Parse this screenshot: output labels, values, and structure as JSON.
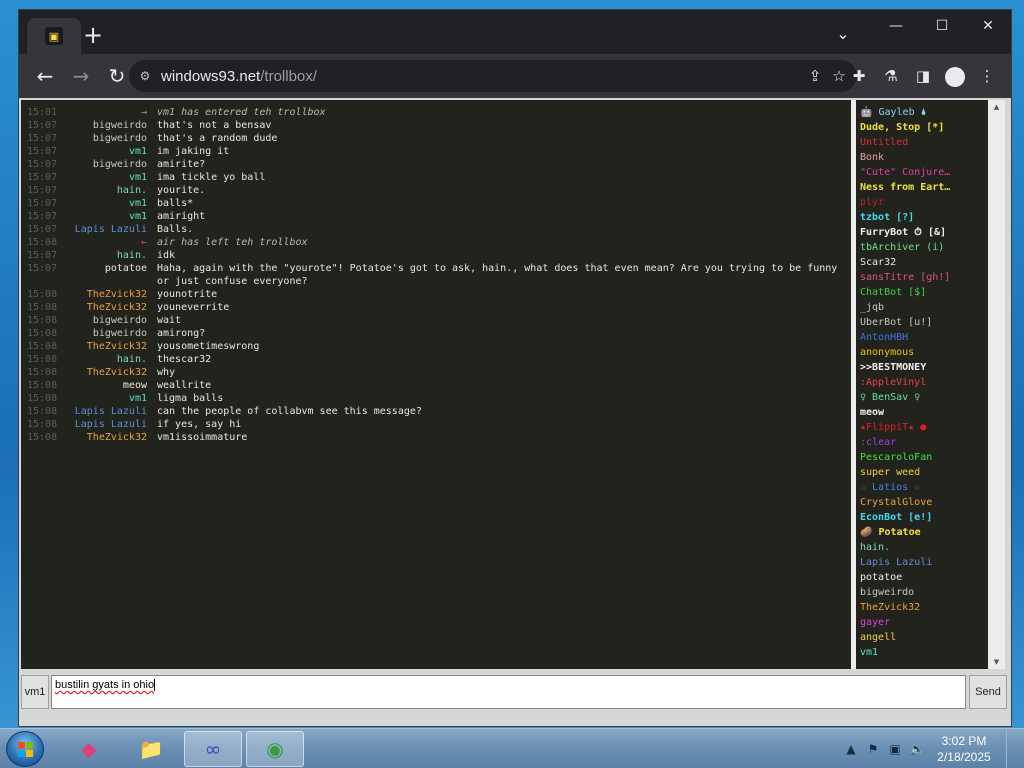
{
  "browser": {
    "new_tab_glyph": "+",
    "tab_search_glyph": "⌄",
    "url_host": "windows93.net",
    "url_path": "/trollbox/",
    "back_glyph": "←",
    "forward_glyph": "→",
    "reload_glyph": "↻",
    "site_info_glyph": "⚙",
    "share_glyph": "⇪",
    "star_glyph": "☆",
    "extensions_glyph": "✚",
    "labs_glyph": "⚗",
    "sidepanel_glyph": "◨",
    "menu_glyph": "⋮",
    "minimize_glyph": "—",
    "maximize_glyph": "☐",
    "close_glyph": "✕"
  },
  "chat": {
    "messages": [
      {
        "time": "15:01",
        "nick": "→",
        "text": "vm1 has entered teh trollbox",
        "system": true,
        "color": "#5fd35f"
      },
      {
        "time": "15:07",
        "nick": "bigweirdo",
        "text": "that's not a bensav",
        "color": "#c8c8c0"
      },
      {
        "time": "15:07",
        "nick": "bigweirdo",
        "text": "that's a random dude",
        "color": "#c8c8c0"
      },
      {
        "time": "15:07",
        "nick": "vm1",
        "text": "im jaking it",
        "color": "#5fe0c8"
      },
      {
        "time": "15:07",
        "nick": "bigweirdo",
        "text": "amirite?",
        "color": "#c8c8c0"
      },
      {
        "time": "15:07",
        "nick": "vm1",
        "text": "ima tickle yo ball",
        "color": "#5fe0c8"
      },
      {
        "time": "15:07",
        "nick": "hain.",
        "text": "yourite.",
        "color": "#7fd8b0"
      },
      {
        "time": "15:07",
        "nick": "vm1",
        "text": "balls*",
        "color": "#5fe0c8"
      },
      {
        "time": "15:07",
        "nick": "vm1",
        "text": "amiright",
        "color": "#5fe0c8"
      },
      {
        "time": "15:07",
        "nick": "Lapis Lazuli",
        "text": "Balls.",
        "color": "#5b8fd6"
      },
      {
        "time": "15:08",
        "nick": "←",
        "text": "air has left teh trollbox",
        "system": true,
        "color": "#e05050"
      },
      {
        "time": "15:07",
        "nick": "hain.",
        "text": "idk",
        "color": "#7fd8b0"
      },
      {
        "time": "15:07",
        "nick": "potatoe",
        "text": "Haha, again with the \"yourote\"! Potatoe's got to ask, hain., what does that even mean? Are you trying to be funny or just confuse everyone?",
        "color": "#e8e8e0",
        "tall": true
      },
      {
        "time": "15:08",
        "nick": "TheZvick32",
        "text": "younotrite",
        "color": "#e8a040"
      },
      {
        "time": "15:08",
        "nick": "TheZvick32",
        "text": "youneverrite",
        "color": "#e8a040"
      },
      {
        "time": "15:08",
        "nick": "bigweirdo",
        "text": "wait",
        "color": "#c8c8c0"
      },
      {
        "time": "15:08",
        "nick": "bigweirdo",
        "text": "amirong?",
        "color": "#c8c8c0"
      },
      {
        "time": "15:08",
        "nick": "TheZvick32",
        "text": "yousometimeswrong",
        "color": "#e8a040"
      },
      {
        "time": "15:08",
        "nick": "hain.",
        "text": "thescar32",
        "color": "#7fd8b0"
      },
      {
        "time": "15:08",
        "nick": "TheZvick32",
        "text": "why",
        "color": "#e8a040"
      },
      {
        "time": "15:08",
        "nick": "meow",
        "text": "weallrite",
        "color": "#e8e8e0"
      },
      {
        "time": "15:08",
        "nick": "vm1",
        "text": "ligma balls",
        "color": "#5fe0c8"
      },
      {
        "time": "15:08",
        "nick": "Lapis Lazuli",
        "text": "can the people of collabvm see this message?",
        "color": "#5b8fd6"
      },
      {
        "time": "15:08",
        "nick": "Lapis Lazuli",
        "text": "if yes, say hi",
        "color": "#5b8fd6"
      },
      {
        "time": "15:08",
        "nick": "TheZvick32",
        "text": "vm1issoimmature",
        "color": "#e8a040"
      }
    ]
  },
  "users": [
    {
      "name": "🤖 Gayleb 🌢",
      "color": "#8fd0f0"
    },
    {
      "name": "Dude, Stop [*]",
      "color": "#f0e040",
      "bold": true
    },
    {
      "name": "Untitled",
      "color": "#d03030"
    },
    {
      "name": "Bonk",
      "color": "#e8a0a0"
    },
    {
      "name": "\"Cute\" Conjure…",
      "color": "#e040a0"
    },
    {
      "name": "Ness from Eart…",
      "color": "#f0e040",
      "bold": true
    },
    {
      "name": "plyr",
      "color": "#c02020"
    },
    {
      "name": "tzbot [?]",
      "color": "#40d8f0",
      "bold": true
    },
    {
      "name": "FurryBot ⏱ [&]",
      "color": "#f0f0f0",
      "bold": true
    },
    {
      "name": "tbArchiver (i)",
      "color": "#6fe08f"
    },
    {
      "name": "Scar32",
      "color": "#e8e8e0"
    },
    {
      "name": "sansTitre [gh!]",
      "color": "#e05080"
    },
    {
      "name": "ChatBot [$]",
      "color": "#40d040"
    },
    {
      "name": "_jqb",
      "color": "#c8c8c0"
    },
    {
      "name": "UberBot [u!]",
      "color": "#c8c8c0"
    },
    {
      "name": "AntonHBH",
      "color": "#4070e0"
    },
    {
      "name": "anonymous",
      "color": "#f0c000"
    },
    {
      "name": ">>BESTMONEY",
      "color": "#f0f0f0",
      "bold": true
    },
    {
      "name": ":AppleVinyl",
      "color": "#f04040"
    },
    {
      "name": "♀ BenSav ♀",
      "color": "#60e0a0"
    },
    {
      "name": "meow",
      "color": "#f0f0f0",
      "bold": true
    },
    {
      "name": "★FlippiT★ ●",
      "color": "#e02020"
    },
    {
      "name": ":clear",
      "color": "#a040e0"
    },
    {
      "name": "PescaroloFan",
      "color": "#40e040"
    },
    {
      "name": "super weed",
      "color": "#f0d040"
    },
    {
      "name": "☆ Latios ☆",
      "color": "#4080f0"
    },
    {
      "name": "CrystalGlove",
      "color": "#f0a040"
    },
    {
      "name": "EconBot [e!]",
      "color": "#40d8f0",
      "bold": true
    },
    {
      "name": "🥔 Potatoe",
      "color": "#f0e040",
      "bold": true
    },
    {
      "name": "hain.",
      "color": "#7fd8b0"
    },
    {
      "name": "Lapis Lazuli",
      "color": "#5b8fd6"
    },
    {
      "name": "potatoe",
      "color": "#f0f0f0"
    },
    {
      "name": "bigweirdo",
      "color": "#c8c8c0"
    },
    {
      "name": "TheZvick32",
      "color": "#e8a040"
    },
    {
      "name": "gayer",
      "color": "#e040e0"
    },
    {
      "name": "angell",
      "color": "#f0d040"
    },
    {
      "name": "vm1",
      "color": "#5fe0c8"
    }
  ],
  "input": {
    "nick_label": "vm1",
    "value": "bustilin gyats in ohio",
    "send_label": "Send"
  },
  "taskbar": {
    "apps": [
      {
        "name": "windows93-app-icon",
        "glyph": "◆",
        "color": "#e0407a"
      },
      {
        "name": "file-explorer-icon",
        "glyph": "📁",
        "color": "#f0c040"
      },
      {
        "name": "infinity-app-icon",
        "glyph": "∞",
        "color": "#3050c0"
      },
      {
        "name": "chrome-browser-icon",
        "glyph": "◉",
        "color": "#3a9a40"
      }
    ],
    "clock_time": "3:02 PM",
    "clock_date": "2/18/2025",
    "tray": {
      "chevron_glyph": "▲",
      "flag_glyph": "⚑",
      "network_glyph": "▣",
      "volume_glyph": "🔈"
    }
  }
}
